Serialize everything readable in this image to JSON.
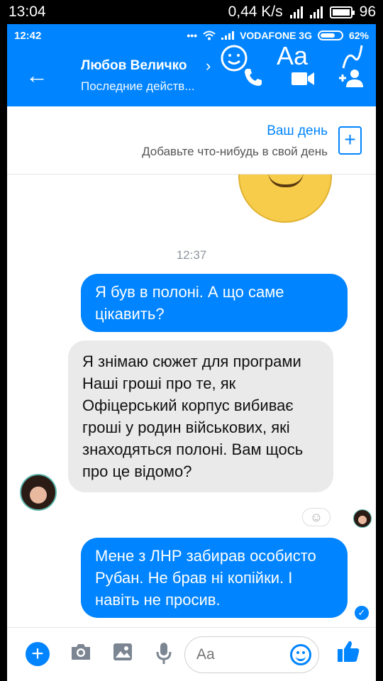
{
  "outer_status": {
    "time": "13:04",
    "network_speed": "0,44 K/s",
    "battery": "96"
  },
  "inner_status": {
    "time": "12:42",
    "carrier": "VODAFONE 3G",
    "battery": "62%"
  },
  "header": {
    "contact_name": "Любов Величко",
    "contact_status": "Последние действ...",
    "overlay_aa": "Aa"
  },
  "story": {
    "title": "Ваш день",
    "subtitle": "Добавьте что-нибудь в свой день"
  },
  "messages": {
    "timestamp": "12:37",
    "m1": "Я був в полоні. А що саме цікавить?",
    "m2": "Я знімаю сюжет для програми Наші гроші про те, як Офіцерський корпус вибиває гроші у родин військових, які знаходяться полоні. Вам щось про це відомо?",
    "m3": "Мене з ЛНР забирав особисто Рубан. Не брав ні копійки. І навіть не просив."
  },
  "composer": {
    "placeholder": "Aa"
  },
  "colors": {
    "messenger_blue": "#0084ff",
    "incoming_bubble": "#eaeaea"
  }
}
